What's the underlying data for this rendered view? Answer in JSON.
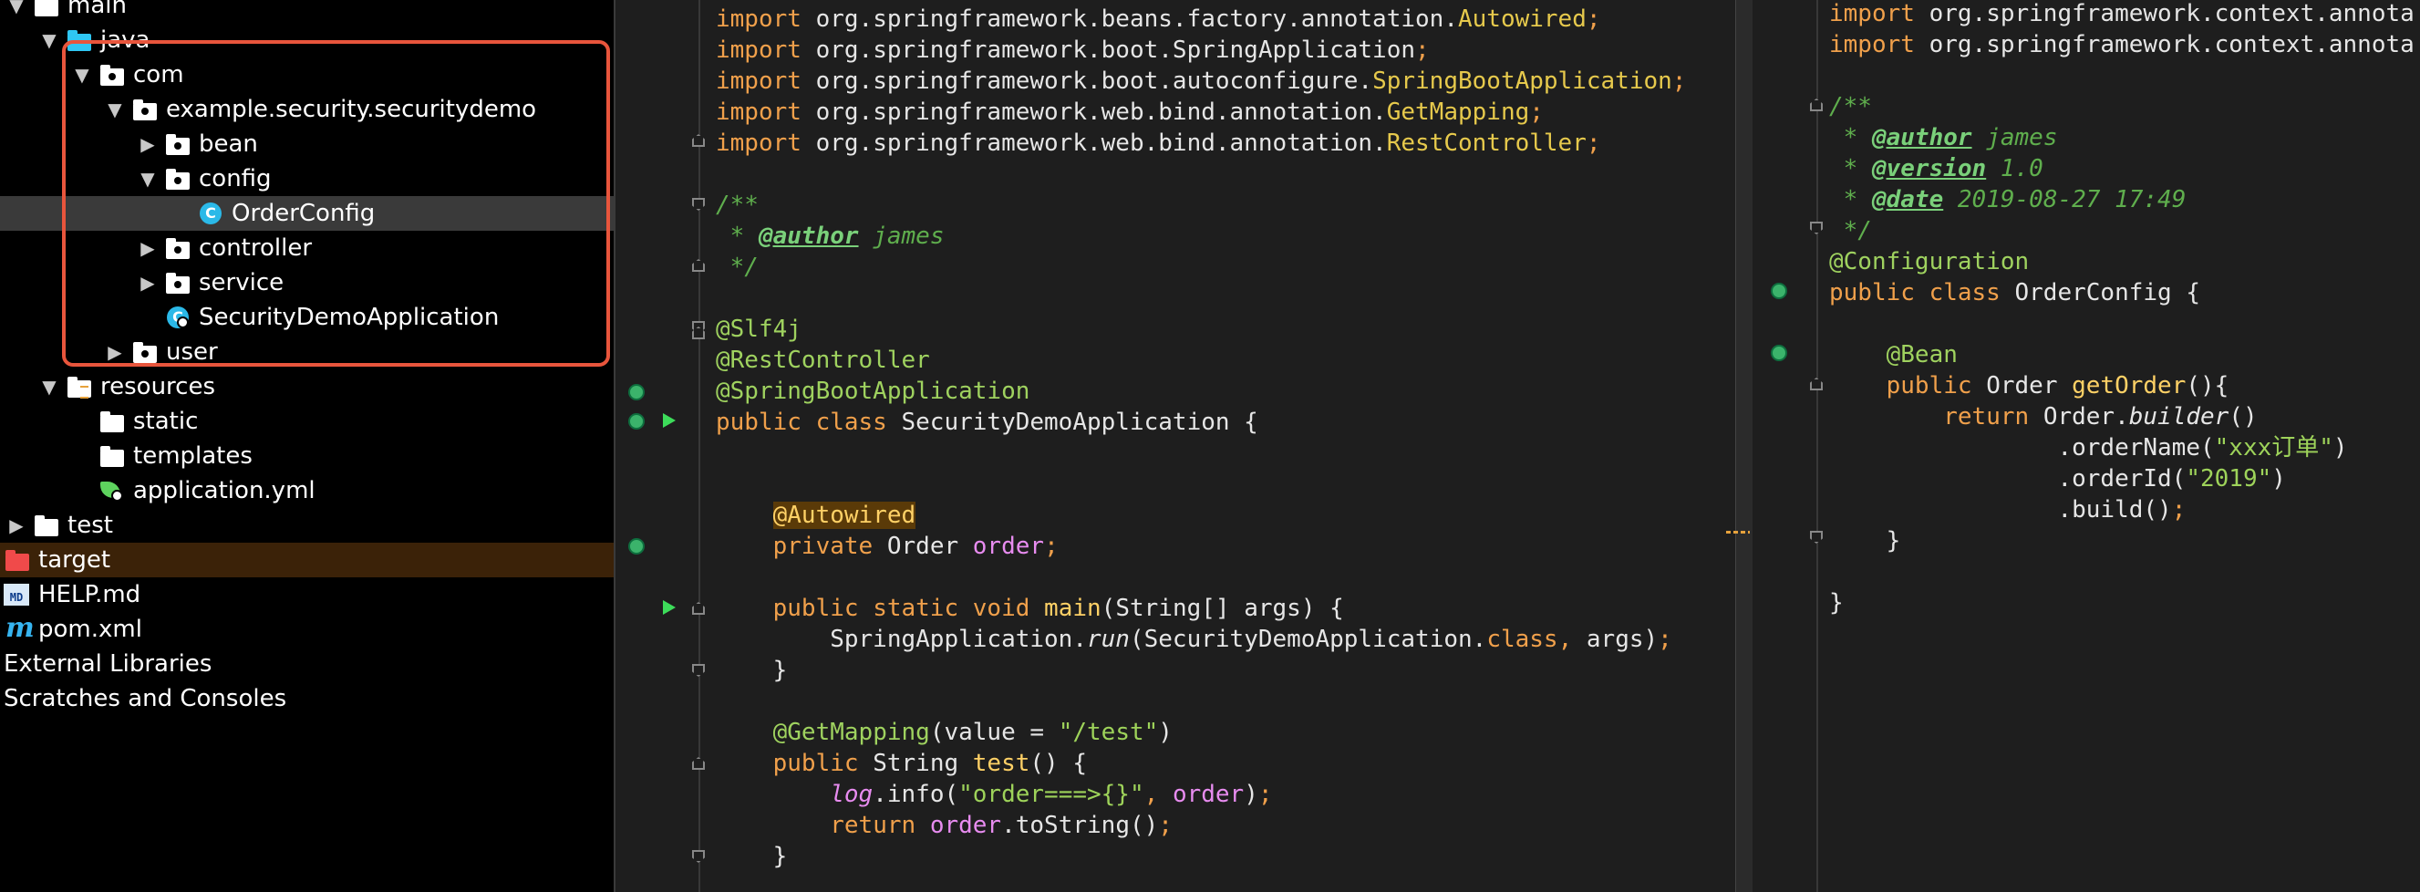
{
  "project_tree": {
    "items": [
      {
        "label": "main",
        "indent": 0,
        "arrow": "down",
        "icon": "folder-icon"
      },
      {
        "label": "java",
        "indent": 1,
        "arrow": "down",
        "icon": "source-folder-icon"
      },
      {
        "label": "com",
        "indent": 2,
        "arrow": "down",
        "icon": "package-folder-icon"
      },
      {
        "label": "example.security.securitydemo",
        "indent": 3,
        "arrow": "down",
        "icon": "package-folder-icon"
      },
      {
        "label": "bean",
        "indent": 4,
        "arrow": "right",
        "icon": "package-folder-icon"
      },
      {
        "label": "config",
        "indent": 4,
        "arrow": "down",
        "icon": "package-folder-icon"
      },
      {
        "label": "OrderConfig",
        "indent": 5,
        "arrow": "none",
        "icon": "class-icon",
        "selected": true
      },
      {
        "label": "controller",
        "indent": 4,
        "arrow": "right",
        "icon": "package-folder-icon"
      },
      {
        "label": "service",
        "indent": 4,
        "arrow": "right",
        "icon": "package-folder-icon"
      },
      {
        "label": "SecurityDemoApplication",
        "indent": 4,
        "arrow": "none",
        "icon": "spring-boot-class-icon"
      },
      {
        "label": "user",
        "indent": 3,
        "arrow": "right",
        "icon": "package-folder-icon"
      },
      {
        "label": "resources",
        "indent": 1,
        "arrow": "down",
        "icon": "resources-folder-icon"
      },
      {
        "label": "static",
        "indent": 2,
        "arrow": "none",
        "icon": "folder-icon"
      },
      {
        "label": "templates",
        "indent": 2,
        "arrow": "none",
        "icon": "folder-icon"
      },
      {
        "label": "application.yml",
        "indent": 2,
        "arrow": "none",
        "icon": "spring-config-icon"
      },
      {
        "label": "test",
        "indent": 0,
        "arrow": "right",
        "icon": "folder-icon"
      },
      {
        "label": "target",
        "indent": -1,
        "arrow": "none",
        "icon": "excluded-folder-icon",
        "excluded": true
      },
      {
        "label": "HELP.md",
        "indent": -1,
        "arrow": "none",
        "icon": "markdown-file-icon"
      },
      {
        "label": "pom.xml",
        "indent": -1,
        "arrow": "none",
        "icon": "maven-icon"
      },
      {
        "label": "External Libraries",
        "indent": -1,
        "arrow": "none",
        "icon": ""
      },
      {
        "label": "Scratches and Consoles",
        "indent": -1,
        "arrow": "none",
        "icon": ""
      }
    ]
  },
  "editor_left": {
    "file": "SecurityDemoApplication.java",
    "lines": [
      [
        [
          "kw",
          "import "
        ],
        [
          "plain",
          "org.springframework.beans.factory.annotation."
        ],
        [
          "cls-ann",
          "Autowired"
        ],
        [
          "kw",
          ";"
        ]
      ],
      [
        [
          "kw",
          "import "
        ],
        [
          "plain",
          "org.springframework.boot.SpringApplication"
        ],
        [
          "kw",
          ";"
        ]
      ],
      [
        [
          "kw",
          "import "
        ],
        [
          "plain",
          "org.springframework.boot.autoconfigure."
        ],
        [
          "cls-ann",
          "SpringBootApplication"
        ],
        [
          "kw",
          ";"
        ]
      ],
      [
        [
          "kw",
          "import "
        ],
        [
          "plain",
          "org.springframework.web.bind.annotation."
        ],
        [
          "cls-ann",
          "GetMapping"
        ],
        [
          "kw",
          ";"
        ]
      ],
      [
        [
          "kw",
          "import "
        ],
        [
          "plain",
          "org.springframework.web.bind.annotation."
        ],
        [
          "cls-ann",
          "RestController"
        ],
        [
          "kw",
          ";"
        ]
      ],
      [],
      [
        [
          "cm",
          "/**"
        ]
      ],
      [
        [
          "cm",
          " * "
        ],
        [
          "tag",
          "@author"
        ],
        [
          "cm",
          " james"
        ]
      ],
      [
        [
          "cm",
          " */"
        ]
      ],
      [],
      [
        [
          "ann",
          "@Slf4j"
        ]
      ],
      [
        [
          "ann",
          "@RestController"
        ]
      ],
      [
        [
          "ann",
          "@SpringBootApplication"
        ]
      ],
      [
        [
          "kw",
          "public class "
        ],
        [
          "plain",
          "SecurityDemoApplication {"
        ]
      ],
      [],
      [],
      [
        [
          "plain",
          "    "
        ],
        [
          "hl-bg",
          "@Autowired"
        ]
      ],
      [
        [
          "plain",
          "    "
        ],
        [
          "kw",
          "private "
        ],
        [
          "plain",
          "Order "
        ],
        [
          "fld",
          "order"
        ],
        [
          "kw",
          ";"
        ]
      ],
      [],
      [
        [
          "plain",
          "    "
        ],
        [
          "kw",
          "public static void "
        ],
        [
          "fn",
          "main"
        ],
        [
          "plain",
          "(String[] args) {"
        ]
      ],
      [
        [
          "plain",
          "        SpringApplication."
        ],
        [
          "ital plain",
          "run"
        ],
        [
          "plain",
          "(SecurityDemoApplication."
        ],
        [
          "kw",
          "class, "
        ],
        [
          "plain",
          "args)"
        ],
        [
          "kw",
          ";"
        ]
      ],
      [
        [
          "plain",
          "    }"
        ]
      ],
      [],
      [
        [
          "plain",
          "    "
        ],
        [
          "ann",
          "@GetMapping"
        ],
        [
          "plain",
          "(value = "
        ],
        [
          "str",
          "\"/test\""
        ],
        [
          "plain",
          ")"
        ]
      ],
      [
        [
          "plain",
          "    "
        ],
        [
          "kw",
          "public "
        ],
        [
          "plain",
          "String "
        ],
        [
          "fn",
          "test"
        ],
        [
          "plain",
          "() {"
        ]
      ],
      [
        [
          "plain",
          "        "
        ],
        [
          "fld ital",
          "log"
        ],
        [
          "plain",
          ".info("
        ],
        [
          "str",
          "\"order===>{}\""
        ],
        [
          "kw",
          ", "
        ],
        [
          "fld",
          "order"
        ],
        [
          "plain",
          ")"
        ],
        [
          "kw",
          ";"
        ]
      ],
      [
        [
          "plain",
          "        "
        ],
        [
          "kw",
          "return "
        ],
        [
          "fld",
          "order"
        ],
        [
          "plain",
          ".toString()"
        ],
        [
          "kw",
          ";"
        ]
      ],
      [
        [
          "plain",
          "    }"
        ]
      ]
    ]
  },
  "editor_right": {
    "file": "OrderConfig.java",
    "lines": [
      [
        [
          "kw",
          "import "
        ],
        [
          "plain",
          "org.springframework.context.annota"
        ]
      ],
      [
        [
          "kw",
          "import "
        ],
        [
          "plain",
          "org.springframework.context.annota"
        ]
      ],
      [],
      [
        [
          "cm",
          "/**"
        ]
      ],
      [
        [
          "cm",
          " * "
        ],
        [
          "tag",
          "@author"
        ],
        [
          "cm",
          " james"
        ]
      ],
      [
        [
          "cm",
          " * "
        ],
        [
          "tag",
          "@version"
        ],
        [
          "cm",
          " 1.0"
        ]
      ],
      [
        [
          "cm",
          " * "
        ],
        [
          "tag",
          "@date"
        ],
        [
          "cm",
          " 2019-08-27 17:49"
        ]
      ],
      [
        [
          "cm",
          " */"
        ]
      ],
      [
        [
          "ann",
          "@Configuration"
        ]
      ],
      [
        [
          "kw",
          "public class "
        ],
        [
          "plain",
          "OrderConfig {"
        ]
      ],
      [],
      [
        [
          "plain",
          "    "
        ],
        [
          "ann",
          "@Bean"
        ]
      ],
      [
        [
          "plain",
          "    "
        ],
        [
          "kw",
          "public "
        ],
        [
          "plain",
          "Order "
        ],
        [
          "fn",
          "getOrder"
        ],
        [
          "plain",
          "(){"
        ]
      ],
      [
        [
          "plain",
          "        "
        ],
        [
          "kw",
          "return "
        ],
        [
          "plain",
          "Order."
        ],
        [
          "ital plain",
          "builder"
        ],
        [
          "plain",
          "()"
        ]
      ],
      [
        [
          "plain",
          "                .orderName("
        ],
        [
          "str",
          "\"xxx订单\""
        ],
        [
          "plain",
          ")"
        ]
      ],
      [
        [
          "plain",
          "                .orderId("
        ],
        [
          "str",
          "\"2019\""
        ],
        [
          "plain",
          ")"
        ]
      ],
      [
        [
          "plain",
          "                .build()"
        ],
        [
          "kw",
          ";"
        ]
      ],
      [
        [
          "plain",
          "    }"
        ]
      ],
      [],
      [
        [
          "plain",
          "}"
        ]
      ]
    ]
  }
}
